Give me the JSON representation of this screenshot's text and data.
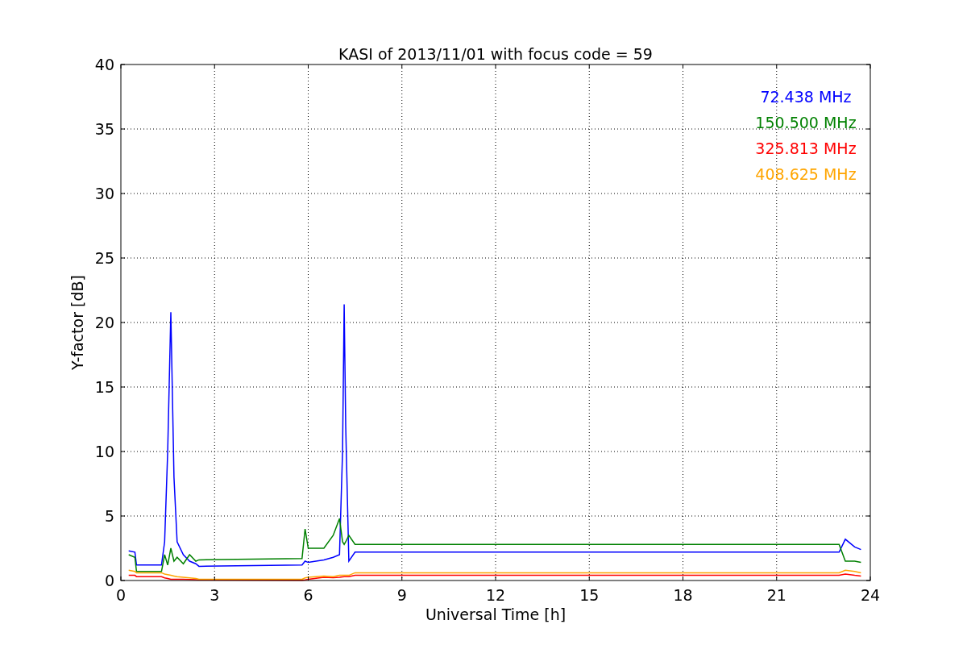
{
  "figure": {
    "chart_data": {
      "type": "line",
      "title": "KASI of 2013/11/01 with focus code = 59",
      "xlabel": "Universal Time [h]",
      "ylabel": "Y-factor [dB]",
      "grid": true,
      "xlim": [
        0,
        24
      ],
      "ylim": [
        0,
        40
      ],
      "xticks": [
        0,
        3,
        6,
        9,
        12,
        15,
        18,
        21,
        24
      ],
      "yticks": [
        0,
        5,
        10,
        15,
        20,
        25,
        30,
        35,
        40
      ],
      "x": [
        0.25,
        0.45,
        0.5,
        1.3,
        1.4,
        1.5,
        1.6,
        1.7,
        1.8,
        2.0,
        2.2,
        2.4,
        2.5,
        5.8,
        5.9,
        6.0,
        6.5,
        6.8,
        7.0,
        7.1,
        7.15,
        7.2,
        7.3,
        7.5,
        23.0,
        23.2,
        23.5,
        23.7
      ],
      "series": [
        {
          "name": "72.438 MHz",
          "color": "#0000ff",
          "values": [
            2.3,
            2.2,
            1.2,
            1.2,
            3,
            10,
            20.8,
            8,
            3,
            2,
            1.5,
            1.3,
            1.1,
            1.2,
            1.5,
            1.4,
            1.6,
            1.8,
            2,
            10,
            21.4,
            12,
            1.5,
            2.2,
            2.2,
            3.2,
            2.6,
            2.4
          ]
        },
        {
          "name": "150.500 MHz",
          "color": "#008000",
          "values": [
            2,
            1.8,
            0.7,
            0.7,
            2,
            1.2,
            2.5,
            1.5,
            1.8,
            1.3,
            2,
            1.5,
            1.6,
            1.7,
            4,
            2.5,
            2.5,
            3.5,
            4.8,
            3,
            2.8,
            3,
            3.5,
            2.8,
            2.8,
            1.5,
            1.5,
            1.4
          ]
        },
        {
          "name": "325.813 MHz",
          "color": "#ff0000",
          "values": [
            0.4,
            0.4,
            0.3,
            0.3,
            0.2,
            0.15,
            0.1,
            0.1,
            0.1,
            0.1,
            0.08,
            0.06,
            0.05,
            0.02,
            0.05,
            0.1,
            0.25,
            0.22,
            0.25,
            0.28,
            0.3,
            0.3,
            0.3,
            0.4,
            0.4,
            0.5,
            0.4,
            0.35
          ]
        },
        {
          "name": "408.625 MHz",
          "color": "#ffa500",
          "values": [
            0.8,
            0.7,
            0.6,
            0.6,
            0.5,
            0.45,
            0.4,
            0.35,
            0.3,
            0.25,
            0.2,
            0.15,
            0.1,
            0.1,
            0.2,
            0.25,
            0.35,
            0.3,
            0.4,
            0.4,
            0.4,
            0.4,
            0.4,
            0.6,
            0.6,
            0.8,
            0.7,
            0.6
          ]
        }
      ]
    }
  }
}
